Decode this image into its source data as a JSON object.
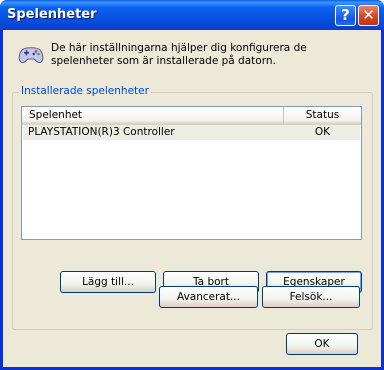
{
  "window": {
    "title": "Spelenheter",
    "help_label": "?",
    "close_label": "✕"
  },
  "info": {
    "icon": "gamepad-icon",
    "text": "De här inställningarna hjälper dig konfigurera de spelenheter som är installerade på datorn."
  },
  "group": {
    "title": "Installerade spelenheter"
  },
  "list": {
    "columns": [
      "Spelenhet",
      "Status"
    ],
    "rows": [
      {
        "device": "PLAYSTATION(R)3 Controller",
        "status": "OK"
      }
    ]
  },
  "buttons": {
    "add": "Lägg till...",
    "remove": "Ta bort",
    "properties": "Egenskaper",
    "advanced": "Avancerat...",
    "troubleshoot": "Felsök...",
    "ok": "OK"
  }
}
